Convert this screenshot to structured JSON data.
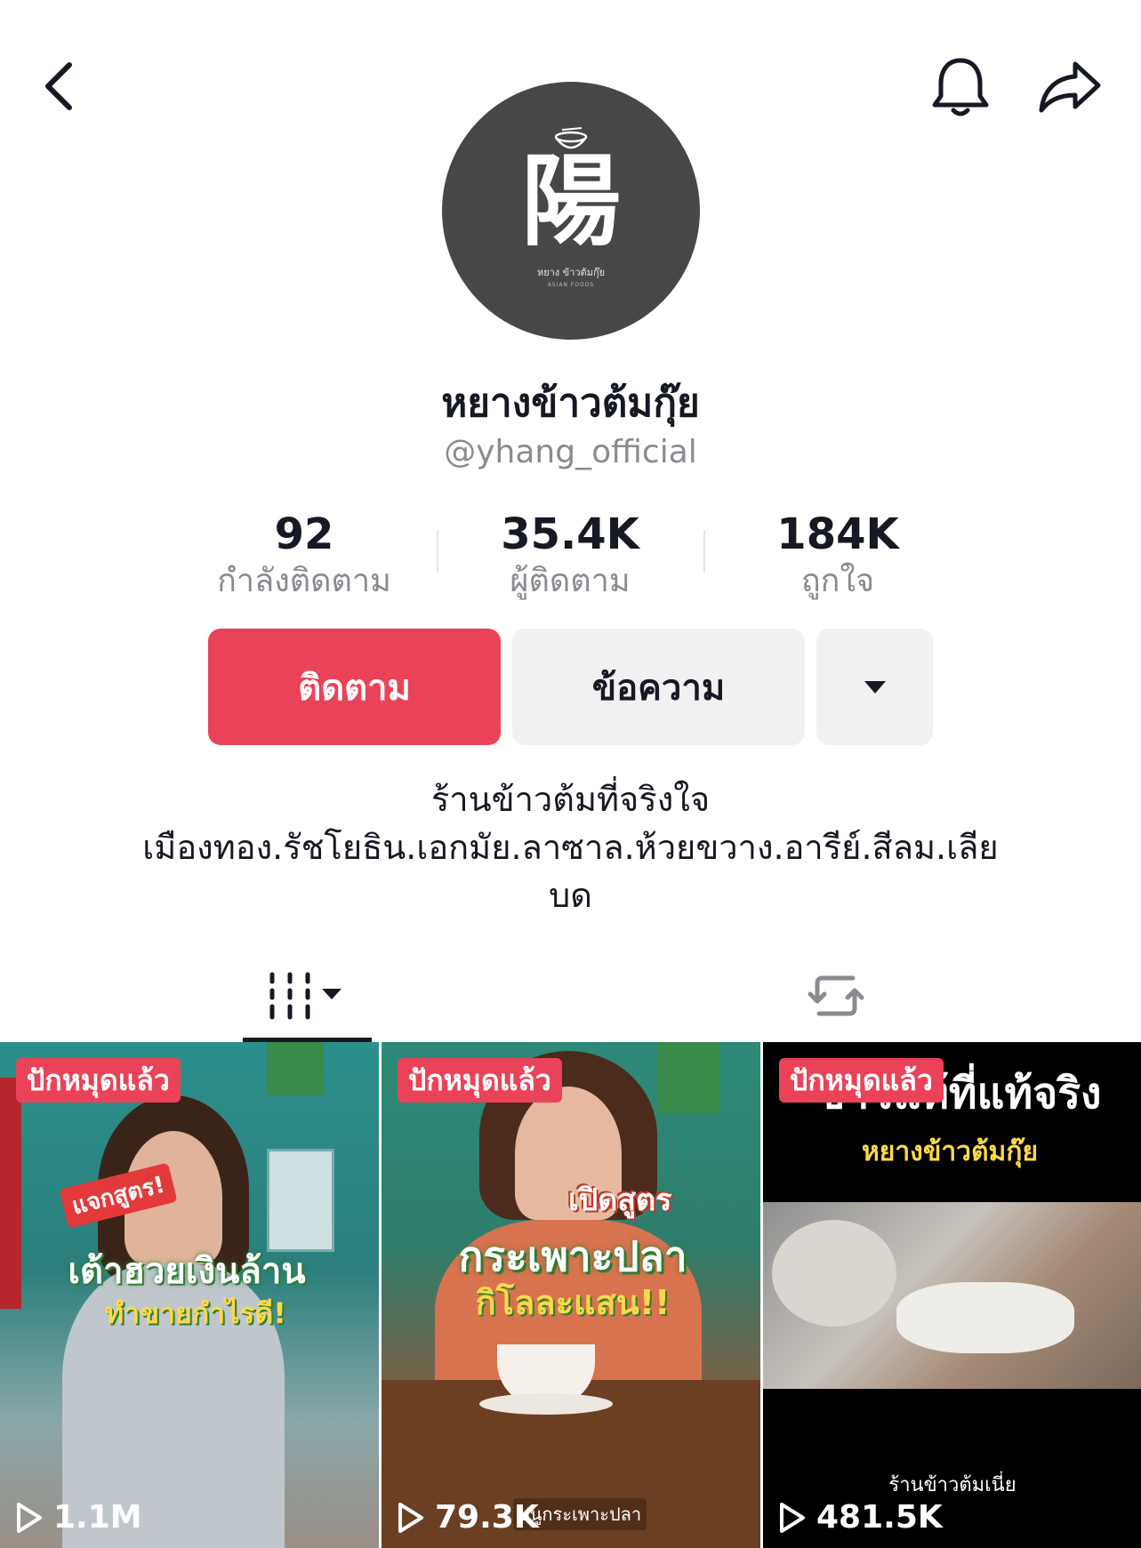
{
  "header": {
    "back_icon": "chevron-left-icon",
    "notification_icon": "bell-icon",
    "share_icon": "share-arrow-icon"
  },
  "profile": {
    "avatar_logo_char": "陽",
    "avatar_logo_caption": "หยาง ข้าวต้มกุ๊ย",
    "avatar_logo_caption2": "ASIAN FOODS",
    "display_name": "หยางข้าวต้มกุ๊ย",
    "username": "@yhang_official"
  },
  "stats": [
    {
      "value": "92",
      "label": "กำลังติดตาม"
    },
    {
      "value": "35.4K",
      "label": "ผู้ติดตาม"
    },
    {
      "value": "184K",
      "label": "ถูกใจ"
    }
  ],
  "actions": {
    "follow_label": "ติดตาม",
    "message_label": "ข้อความ",
    "more_icon": "caret-down-icon"
  },
  "bio": {
    "line1": "ร้านข้าวต้มที่จริงใจ",
    "line2": "เมืองทอง.รัชโยธิน.เอกมัย.ลาซาล.ห้วยขวาง.อารีย์.สีลม.เลีย",
    "line3": "บด"
  },
  "tabs": {
    "videos_icon": "grid-videos-icon",
    "reposts_icon": "repost-icon"
  },
  "videos": [
    {
      "pinned_label": "ปักหมุดแล้ว",
      "views": "1.1M",
      "overlay_small": "แจกสูตร!",
      "overlay_main": "เต้าฮวยเงินล้าน",
      "overlay_sub": "ทำขายกำไรดี!"
    },
    {
      "pinned_label": "ปักหมุดแล้ว",
      "views": "79.3K",
      "overlay_small": "เปิดสูตร",
      "overlay_main": "กระเพาะปลา",
      "overlay_sub": "กิโลละแสน!!",
      "caption": "ปนูกระเพาะปลา"
    },
    {
      "pinned_label": "ปักหมุดแล้ว",
      "views": "481.5K",
      "overlay_main": "ข้าวแท้ที่แท้จริง",
      "overlay_sub": "หยางข้าวต้มกุ๊ย",
      "caption": "ร้านข้าวต้มเนี่ย"
    }
  ],
  "colors": {
    "accent": "#ea4359",
    "secondary_button": "#f1f1f2",
    "text_primary": "#161823",
    "text_secondary": "#8a8b91"
  }
}
